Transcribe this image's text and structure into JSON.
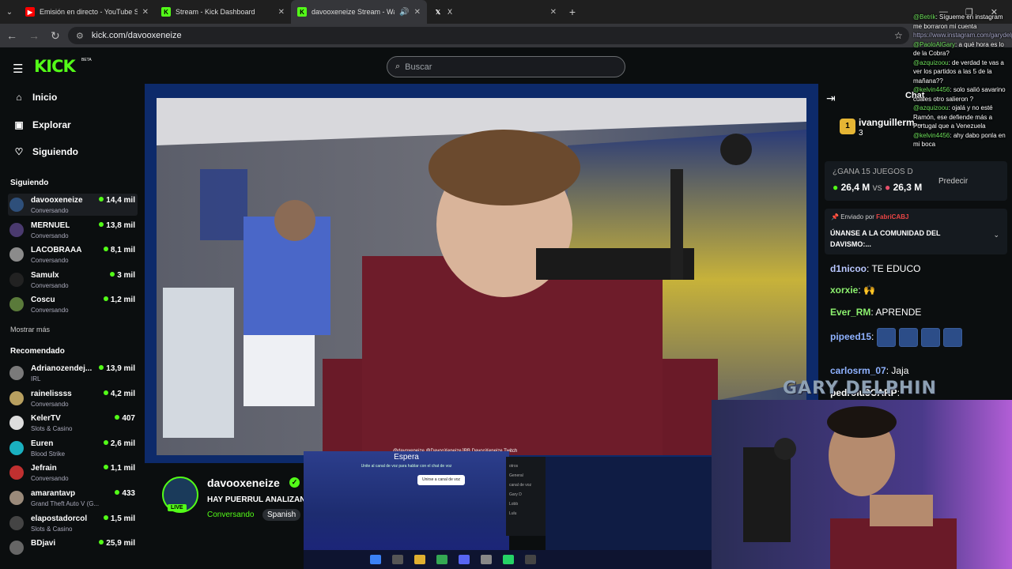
{
  "browser": {
    "tabs": [
      {
        "title": "Emisión en directo - YouTube Studio",
        "favicon": "youtube-icon",
        "color": "#ff0000"
      },
      {
        "title": "Stream - Kick Dashboard",
        "favicon": "kick-icon",
        "color": "#53fc18"
      },
      {
        "title": "davooxeneize Stream - Watch",
        "favicon": "kick-icon",
        "color": "#53fc18"
      },
      {
        "title": "X",
        "favicon": "x-icon",
        "color": "#ffffff"
      }
    ],
    "url": "kick.com/davooxeneize"
  },
  "site": {
    "logo": "KICK",
    "beta": "BETA",
    "search_placeholder": "Buscar"
  },
  "sidebar": {
    "nav": [
      {
        "label": "Inicio",
        "icon": "home-icon"
      },
      {
        "label": "Explorar",
        "icon": "browse-icon"
      },
      {
        "label": "Siguiendo",
        "icon": "heart-icon"
      }
    ],
    "following_title": "Siguiendo",
    "following": [
      {
        "name": "davooxeneize",
        "category": "Conversando",
        "viewers": "14,4 mil",
        "color": "#2e4f7a"
      },
      {
        "name": "MERNUEL",
        "category": "Conversando",
        "viewers": "13,8 mil",
        "color": "#4a3a6e"
      },
      {
        "name": "LACOBRAAA",
        "category": "Conversando",
        "viewers": "8,1 mil",
        "color": "#8b8b8b"
      },
      {
        "name": "Samulx",
        "category": "Conversando",
        "viewers": "3 mil",
        "color": "#222222"
      },
      {
        "name": "Coscu",
        "category": "Conversando",
        "viewers": "1,2 mil",
        "color": "#5a7a3a"
      }
    ],
    "show_more": "Mostrar más",
    "recommended_title": "Recomendado",
    "recommended": [
      {
        "name": "Adrianozendej...",
        "category": "IRL",
        "viewers": "13,9 mil",
        "color": "#7a7a7a"
      },
      {
        "name": "rainelissss",
        "category": "Conversando",
        "viewers": "4,2 mil",
        "color": "#b8a060"
      },
      {
        "name": "KelerTV",
        "category": "Slots & Casino",
        "viewers": "407",
        "color": "#dddddd"
      },
      {
        "name": "Euren",
        "category": "Blood Strike",
        "viewers": "2,6 mil",
        "color": "#1ab0c0"
      },
      {
        "name": "Jefrain",
        "category": "Conversando",
        "viewers": "1,1 mil",
        "color": "#c03030"
      },
      {
        "name": "amarantavp",
        "category": "Grand Theft Auto V (G...",
        "viewers": "433",
        "color": "#9a8a7a"
      },
      {
        "name": "elapostadorcol",
        "category": "Slots & Casino",
        "viewers": "1,5 mil",
        "color": "#444444"
      },
      {
        "name": "BDjavi",
        "category": "",
        "viewers": "25,9 mil",
        "color": "#666666"
      }
    ]
  },
  "stream": {
    "channel": "davooxeneize",
    "title": "HAY PUERRUL ANALIZAN",
    "category": "Conversando",
    "tag": "Spanish",
    "live": "LIVE",
    "ticker": "@davoxeneize   @DavooXeneizeJRB   DavooXeneize Twitch"
  },
  "chat": {
    "header": "Chat",
    "pinned_user": "ivanguillerm...",
    "pinned_count": "3",
    "prediction": {
      "question": "¿GANA 15 JUEGOS D",
      "left": "26,4 M",
      "vs": "vs",
      "right": "26,3 M",
      "action": "Predecir"
    },
    "pinned_msg": {
      "by_label": "Enviado por",
      "by_user": "FabriCABJ",
      "text": "ÚNANSE A LA COMUNIDAD DEL DAVISMO:..."
    },
    "messages": [
      {
        "user": "d1nicoo",
        "text": "TE EDUCO",
        "color": "#b9c7ff"
      },
      {
        "user": "xorxie",
        "text": "🙌",
        "color": "#8cf06e"
      },
      {
        "user": "Ever_RM",
        "text": "APRENDE",
        "color": "#8cf06e"
      },
      {
        "user": "pipeed15",
        "text": "",
        "color": "#8fb2ff"
      },
      {
        "user": "carlosrm_07",
        "text": "Jaja",
        "color": "#8fb2ff"
      },
      {
        "user": "pedrolu3CARP",
        "text": "",
        "color": "#ffffff"
      }
    ]
  },
  "overlay": {
    "name_tag": "GARY DELPHIN",
    "espera_title": "Espera",
    "espera_sub": "Unite al canal de voz para hablar con el chat de voz",
    "espera_button": "Unirse a canal de voz",
    "panel_items": [
      "otros",
      "General",
      "canal de voz",
      "Gary D",
      "Lobb",
      "Lulu"
    ],
    "chat_lines": [
      {
        "user": "@Betrik",
        "text": ": Sígueme en instagram me borraron mi cuenta"
      },
      {
        "user": "",
        "text": "https://www.instagram.com/garydelphinfutbol"
      },
      {
        "user": "@PaoloAlGary",
        "text": ": a qué hora es lo de la Cobra?"
      },
      {
        "user": "@azquizoou",
        "text": ": de verdad te vas a ver los partidos a las 5 de la mañana??"
      },
      {
        "user": "@kelvin4456",
        "text": ": solo salió savarino cuales otro salieron ?"
      },
      {
        "user": "@azquizoou",
        "text": ": ojalá y no esté Ramón, ese defiende más a Portugal que a Venezuela"
      },
      {
        "user": "@kelvin4456",
        "text": ": ahy dabo ponla en mi boca"
      }
    ]
  }
}
